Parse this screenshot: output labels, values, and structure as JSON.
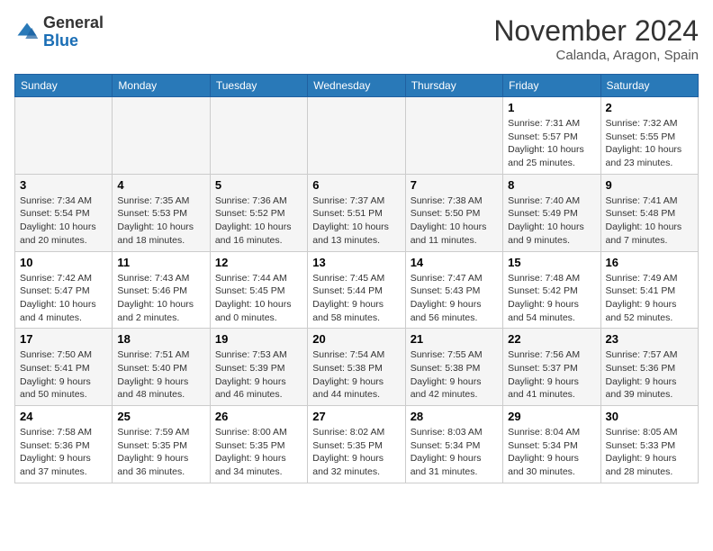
{
  "header": {
    "logo_general": "General",
    "logo_blue": "Blue",
    "month": "November 2024",
    "location": "Calanda, Aragon, Spain"
  },
  "weekdays": [
    "Sunday",
    "Monday",
    "Tuesday",
    "Wednesday",
    "Thursday",
    "Friday",
    "Saturday"
  ],
  "weeks": [
    [
      {
        "day": "",
        "empty": true
      },
      {
        "day": "",
        "empty": true
      },
      {
        "day": "",
        "empty": true
      },
      {
        "day": "",
        "empty": true
      },
      {
        "day": "",
        "empty": true
      },
      {
        "day": "1",
        "sunrise": "7:31 AM",
        "sunset": "5:57 PM",
        "daylight": "10 hours and 25 minutes."
      },
      {
        "day": "2",
        "sunrise": "7:32 AM",
        "sunset": "5:55 PM",
        "daylight": "10 hours and 23 minutes."
      }
    ],
    [
      {
        "day": "3",
        "sunrise": "7:34 AM",
        "sunset": "5:54 PM",
        "daylight": "10 hours and 20 minutes."
      },
      {
        "day": "4",
        "sunrise": "7:35 AM",
        "sunset": "5:53 PM",
        "daylight": "10 hours and 18 minutes."
      },
      {
        "day": "5",
        "sunrise": "7:36 AM",
        "sunset": "5:52 PM",
        "daylight": "10 hours and 16 minutes."
      },
      {
        "day": "6",
        "sunrise": "7:37 AM",
        "sunset": "5:51 PM",
        "daylight": "10 hours and 13 minutes."
      },
      {
        "day": "7",
        "sunrise": "7:38 AM",
        "sunset": "5:50 PM",
        "daylight": "10 hours and 11 minutes."
      },
      {
        "day": "8",
        "sunrise": "7:40 AM",
        "sunset": "5:49 PM",
        "daylight": "10 hours and 9 minutes."
      },
      {
        "day": "9",
        "sunrise": "7:41 AM",
        "sunset": "5:48 PM",
        "daylight": "10 hours and 7 minutes."
      }
    ],
    [
      {
        "day": "10",
        "sunrise": "7:42 AM",
        "sunset": "5:47 PM",
        "daylight": "10 hours and 4 minutes."
      },
      {
        "day": "11",
        "sunrise": "7:43 AM",
        "sunset": "5:46 PM",
        "daylight": "10 hours and 2 minutes."
      },
      {
        "day": "12",
        "sunrise": "7:44 AM",
        "sunset": "5:45 PM",
        "daylight": "10 hours and 0 minutes."
      },
      {
        "day": "13",
        "sunrise": "7:45 AM",
        "sunset": "5:44 PM",
        "daylight": "9 hours and 58 minutes."
      },
      {
        "day": "14",
        "sunrise": "7:47 AM",
        "sunset": "5:43 PM",
        "daylight": "9 hours and 56 minutes."
      },
      {
        "day": "15",
        "sunrise": "7:48 AM",
        "sunset": "5:42 PM",
        "daylight": "9 hours and 54 minutes."
      },
      {
        "day": "16",
        "sunrise": "7:49 AM",
        "sunset": "5:41 PM",
        "daylight": "9 hours and 52 minutes."
      }
    ],
    [
      {
        "day": "17",
        "sunrise": "7:50 AM",
        "sunset": "5:41 PM",
        "daylight": "9 hours and 50 minutes."
      },
      {
        "day": "18",
        "sunrise": "7:51 AM",
        "sunset": "5:40 PM",
        "daylight": "9 hours and 48 minutes."
      },
      {
        "day": "19",
        "sunrise": "7:53 AM",
        "sunset": "5:39 PM",
        "daylight": "9 hours and 46 minutes."
      },
      {
        "day": "20",
        "sunrise": "7:54 AM",
        "sunset": "5:38 PM",
        "daylight": "9 hours and 44 minutes."
      },
      {
        "day": "21",
        "sunrise": "7:55 AM",
        "sunset": "5:38 PM",
        "daylight": "9 hours and 42 minutes."
      },
      {
        "day": "22",
        "sunrise": "7:56 AM",
        "sunset": "5:37 PM",
        "daylight": "9 hours and 41 minutes."
      },
      {
        "day": "23",
        "sunrise": "7:57 AM",
        "sunset": "5:36 PM",
        "daylight": "9 hours and 39 minutes."
      }
    ],
    [
      {
        "day": "24",
        "sunrise": "7:58 AM",
        "sunset": "5:36 PM",
        "daylight": "9 hours and 37 minutes."
      },
      {
        "day": "25",
        "sunrise": "7:59 AM",
        "sunset": "5:35 PM",
        "daylight": "9 hours and 36 minutes."
      },
      {
        "day": "26",
        "sunrise": "8:00 AM",
        "sunset": "5:35 PM",
        "daylight": "9 hours and 34 minutes."
      },
      {
        "day": "27",
        "sunrise": "8:02 AM",
        "sunset": "5:35 PM",
        "daylight": "9 hours and 32 minutes."
      },
      {
        "day": "28",
        "sunrise": "8:03 AM",
        "sunset": "5:34 PM",
        "daylight": "9 hours and 31 minutes."
      },
      {
        "day": "29",
        "sunrise": "8:04 AM",
        "sunset": "5:34 PM",
        "daylight": "9 hours and 30 minutes."
      },
      {
        "day": "30",
        "sunrise": "8:05 AM",
        "sunset": "5:33 PM",
        "daylight": "9 hours and 28 minutes."
      }
    ]
  ]
}
